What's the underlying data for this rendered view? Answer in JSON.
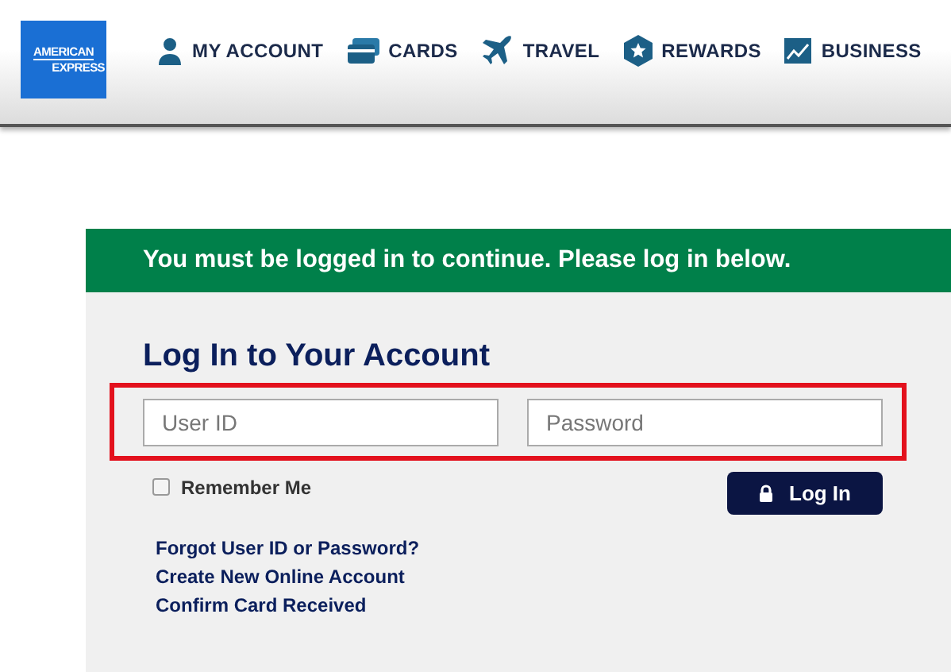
{
  "logo": {
    "line_1": "AMERICAN",
    "line_2": "EXPRESS"
  },
  "nav": [
    {
      "kind": "account",
      "label": "MY ACCOUNT"
    },
    {
      "kind": "cards",
      "label": "CARDS"
    },
    {
      "kind": "travel",
      "label": "TRAVEL"
    },
    {
      "kind": "rewards",
      "label": "REWARDS"
    },
    {
      "kind": "business",
      "label": "BUSINESS"
    }
  ],
  "banner": "You must be logged in to continue. Please log in below.",
  "login": {
    "title": "Log In to Your Account",
    "user_id": {
      "placeholder": "User ID"
    },
    "password": {
      "placeholder": "Password"
    },
    "remember_me": {
      "label": "Remember Me",
      "checked": false
    },
    "button": "Log In",
    "links": [
      "Forgot User ID or Password?",
      "Create New Online Account",
      "Confirm Card Received"
    ]
  }
}
